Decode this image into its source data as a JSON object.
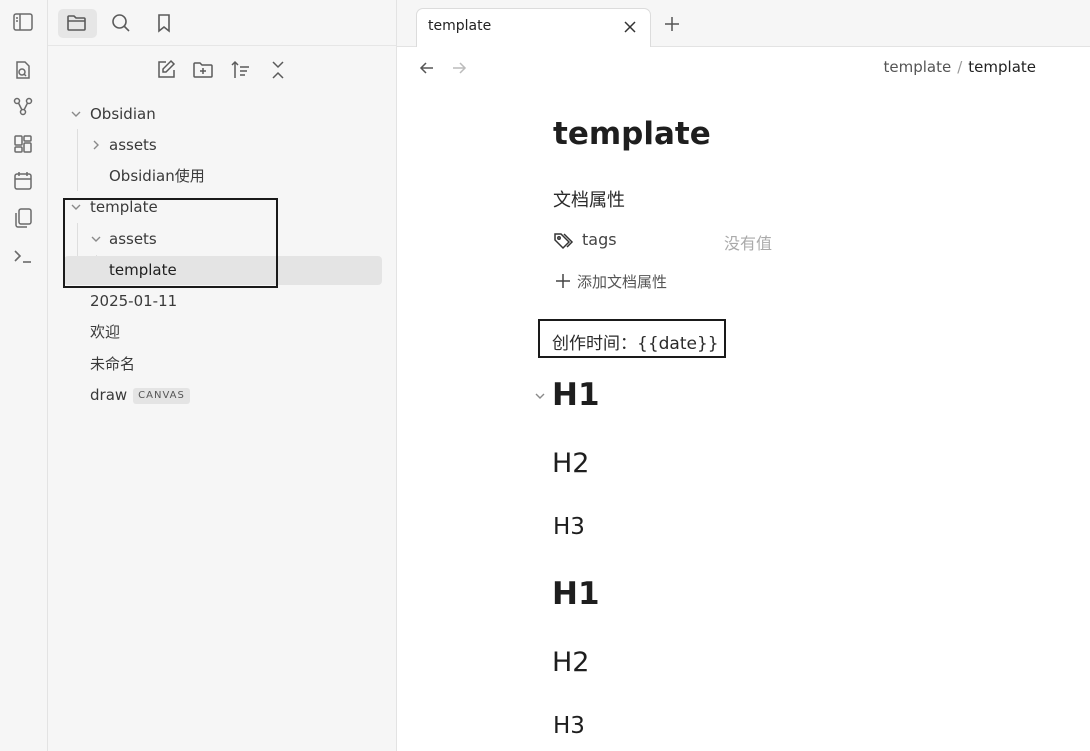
{
  "ribbon": {
    "icons": [
      "toggle-sidebar-icon",
      "quick-switcher-icon",
      "graph-view-icon",
      "canvas-icon",
      "calendar-icon",
      "templates-icon",
      "command-palette-icon"
    ]
  },
  "sidebar": {
    "tabs": [
      "files-tab",
      "search-tab",
      "bookmarks-tab"
    ],
    "nav_buttons": [
      "new-note",
      "new-folder",
      "change-sort-order",
      "collapse-all"
    ],
    "tree": [
      {
        "label": "Obsidian",
        "type": "folder",
        "expanded": true
      },
      {
        "label": "assets",
        "type": "folder",
        "expanded": false
      },
      {
        "label": "Obsidian使用",
        "type": "file"
      },
      {
        "label": "template",
        "type": "folder",
        "expanded": true
      },
      {
        "label": "assets",
        "type": "folder",
        "expanded": true
      },
      {
        "label": "template",
        "type": "file",
        "selected": true
      },
      {
        "label": "2025-01-11",
        "type": "file"
      },
      {
        "label": "欢迎",
        "type": "file"
      },
      {
        "label": "未命名",
        "type": "file"
      },
      {
        "label": "draw",
        "type": "file",
        "badge": "CANVAS"
      }
    ]
  },
  "tab": {
    "title": "template"
  },
  "breadcrumb": {
    "parent": "template",
    "separator": "/",
    "current": "template"
  },
  "document": {
    "title": "template",
    "properties_heading": "文档属性",
    "tags_key": "tags",
    "tags_value": "没有值",
    "add_property": "添加文档属性",
    "created_line": "创作时间：{{date}}",
    "headings": [
      {
        "level": "h1",
        "text": "H1"
      },
      {
        "level": "h2",
        "text": "H2"
      },
      {
        "level": "h3",
        "text": "H3"
      },
      {
        "level": "h1",
        "text": "H1"
      },
      {
        "level": "h2",
        "text": "H2"
      },
      {
        "level": "h3",
        "text": "H3"
      }
    ]
  },
  "colors": {
    "sidebar_bg": "#f6f6f6",
    "selected_bg": "#e4e4e4",
    "annotation_border": "#1a1a1a",
    "placeholder_text": "#aaaaaa"
  }
}
